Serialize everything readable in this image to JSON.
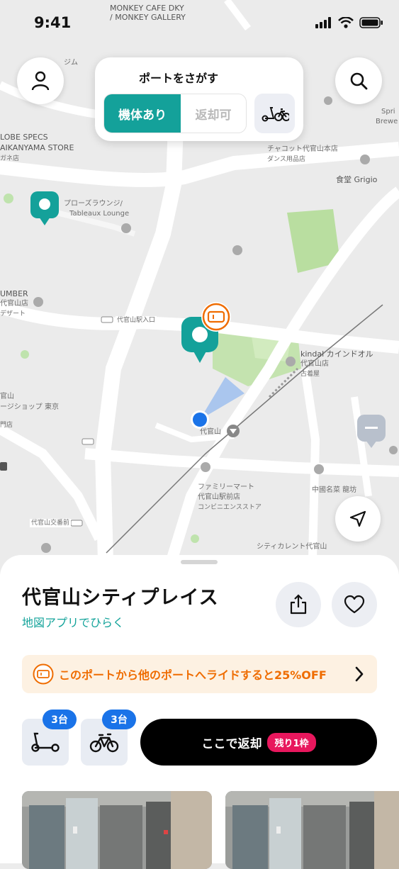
{
  "status_bar": {
    "time": "9:41"
  },
  "search_panel": {
    "title": "ポートをさがす",
    "filter_available": "機体あり",
    "filter_returnable": "返却可",
    "vehicle_icon": "scooter-bike-icon"
  },
  "map": {
    "labels": [
      "MONKEY CAFE DKY",
      "/ MONKEY GALLERY",
      "ジム",
      "LOBE SPECS",
      "AIKANYAMA STORE",
      "ガネ店",
      "チャコット代官山本店",
      "ダンス用品店",
      "食堂 Grigio",
      "プローズラウンジ/",
      "Tableaux Lounge",
      "UMBER",
      "代官山店",
      "デザート",
      "代官山駅入口",
      "kindal カインドオル",
      "代官山店",
      "古着屋",
      "官山",
      "ージショップ 東京",
      "門店",
      "代官山",
      "ファミリーマート",
      "代官山駅前店",
      "コンビニエンスストア",
      "中國名菜 龍坊",
      "代官山交番前",
      "シティカレント代官山",
      "Spri",
      "Brewe"
    ]
  },
  "sheet": {
    "port_name": "代官山シティプレイス",
    "map_link": "地図アプリでひらく",
    "promo": "このポートから他のポートへライドすると25%OFF",
    "scooter_count": "3台",
    "bike_count": "3台",
    "return_label": "ここで返却",
    "remaining": "残り1枠"
  },
  "colors": {
    "teal": "#14a19a",
    "orange": "#ef6c00",
    "blue": "#1a73e8",
    "pink": "#e8175d"
  }
}
